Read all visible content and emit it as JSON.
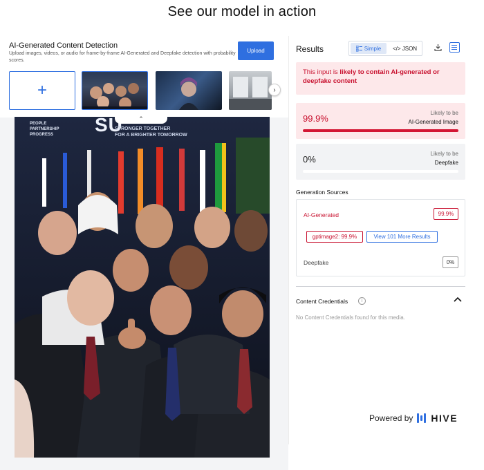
{
  "page": {
    "title": "See our model in action"
  },
  "detection": {
    "title": "AI-Generated Content Detection",
    "description": "Upload images, videos, or audio for frame-by-frame AI-Generated and Deepfake detection with probability scores.",
    "upload_label": "Upload",
    "add_symbol": "+",
    "next_symbol": "›",
    "collapse_symbol": "⌃"
  },
  "photo_banner": {
    "left_text": "PEOPLE\nPARTNERSHIP\nPROGRESS",
    "big_text": "SU",
    "sub_text": "STRONGER TOGETHER\nFOR A BRIGHTER TOMORROW"
  },
  "results": {
    "title": "Results",
    "toggle_simple": "Simple",
    "toggle_json": "</> JSON",
    "alert_prefix": "This input is ",
    "alert_bold": "likely to contain AI-generated or deepfake content",
    "ai_score": "99.9%",
    "ai_caption_top": "Likely to be",
    "ai_caption_bottom": "AI-Generated Image",
    "ai_fraction": 0.999,
    "df_score": "0%",
    "df_caption_top": "Likely to be",
    "df_caption_bottom": "Deepfake",
    "df_fraction": 0.0,
    "gen_title": "Generation Sources",
    "gen_ai_label": "AI-Generated",
    "gen_ai_value": "99.9%",
    "gen_model_pill": "gptimage2: 99.9%",
    "gen_more": "View 101 More Results",
    "gen_df_label": "Deepfake",
    "gen_df_value": "0%",
    "cc_title": "Content Credentials",
    "cc_empty": "No Content Credentials found for this media.",
    "powered_by": "Powered by",
    "brand": "HIVE"
  },
  "colors": {
    "accent": "#2f6fe0",
    "danger": "#c8102e"
  }
}
